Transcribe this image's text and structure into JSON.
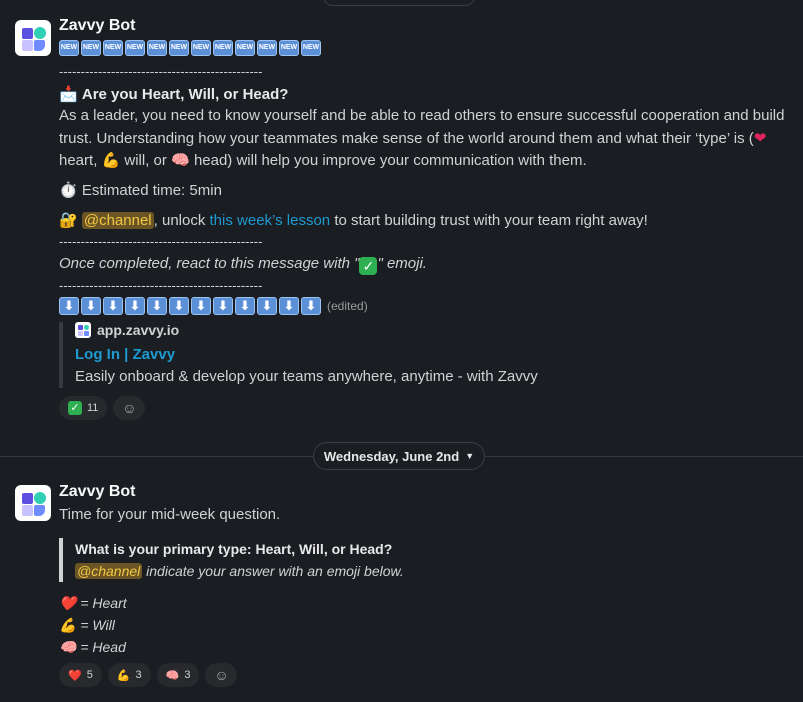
{
  "message1": {
    "bot_name": "Zavvy Bot",
    "badges": [
      "NEW",
      "NEW",
      "NEW",
      "NEW",
      "NEW",
      "NEW",
      "NEW",
      "NEW",
      "NEW",
      "NEW",
      "NEW",
      "NEW"
    ],
    "separator": "-----------------------------------------------",
    "heading_emoji": "📩",
    "heading": "Are you Heart, Will, or Head?",
    "body_line1": "As a leader, you need to know yourself and be able to read others to ensure successful cooperation and build",
    "body_line2": "trust. Understanding how your teammates make sense of the world around them and what their ‘type’ is (",
    "body_line3_a": "heart,",
    "body_line3_b": "will, or",
    "body_line3_c": "head) will help you improve your communication with them.",
    "timer_emoji": "⏱️",
    "estimated_time": "Estimated time: 5min",
    "lock_emoji": "🔐",
    "mention": "@channel",
    "unlock_text": ", unlock",
    "lesson_link": "this week’s lesson",
    "unlock_tail": "to start building trust with your team right away!",
    "react_pre": "Once completed, react to this message with \"",
    "react_post": "\" emoji.",
    "arrow_count_label": "⬇",
    "edited": "(edited)",
    "attachment": {
      "site": "app.zavvy.io",
      "title": "Log In | Zavvy",
      "description": "Easily onboard & develop your teams anywhere, anytime - with Zavvy"
    },
    "reactions": [
      {
        "emoji": "✅",
        "count": "11"
      }
    ]
  },
  "date_divider": {
    "label": "Wednesday, June 2nd",
    "chevron": "chevron-down-icon"
  },
  "message2": {
    "bot_name": "Zavvy Bot",
    "text": "Time for your mid-week question.",
    "quote_title": "What is your primary type: Heart, Will, or Head?",
    "quote_mention": "@channel",
    "quote_tail": "indicate your answer with an emoji below.",
    "legend": [
      {
        "emoji": "❤️",
        "label": "= Heart"
      },
      {
        "emoji": "💪",
        "label": "= Will"
      },
      {
        "emoji": "🧠",
        "label": "= Head"
      }
    ],
    "reactions": [
      {
        "emoji": "❤️",
        "count": "5"
      },
      {
        "emoji": "💪",
        "count": "3"
      },
      {
        "emoji": "🧠",
        "count": "3"
      }
    ]
  },
  "colors": {
    "background": "#1a1d21",
    "link": "#1d9bd1",
    "mention_bg": "#6b5524",
    "mention_text": "#f2c744",
    "badge": "#5b8fd6"
  }
}
